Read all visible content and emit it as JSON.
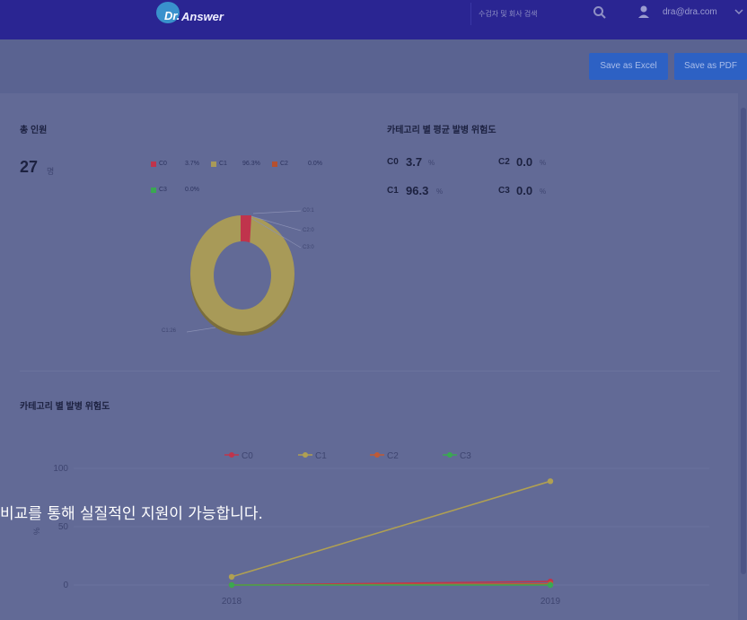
{
  "header": {
    "logo_mark": "Dr.",
    "logo_name": "Answer",
    "search_placeholder": "수검자 및 회사 검색",
    "user_email": "dra@dra.com"
  },
  "toolbar": {
    "save_excel": "Save as Excel",
    "save_pdf": "Save as PDF"
  },
  "summary": {
    "total_title": "총 인원",
    "total_value": "27",
    "total_unit": "명",
    "avg_title": "카테고리 별 평균 발병 위험도",
    "legend": [
      {
        "label": "C0",
        "pct": "3.7%",
        "color": "#c0344c"
      },
      {
        "label": "C1",
        "pct": "96.3%",
        "color": "#a89a58"
      },
      {
        "label": "C2",
        "pct": "0.0%",
        "color": "#b5502f"
      },
      {
        "label": "C3",
        "pct": "0.0%",
        "color": "#3aa852"
      }
    ],
    "donut_labels": [
      "C0:1",
      "C2:0",
      "C3:0",
      "C1:26"
    ],
    "stats": [
      {
        "label": "C0",
        "value": "3.7",
        "unit": "%"
      },
      {
        "label": "C2",
        "value": "0.0",
        "unit": "%"
      },
      {
        "label": "C1",
        "value": "96.3",
        "unit": "%"
      },
      {
        "label": "C3",
        "value": "0.0",
        "unit": "%"
      }
    ]
  },
  "line_section": {
    "title": "카테고리 별 발병 위험도",
    "y_axis_label": "%"
  },
  "chart_data": {
    "type": "line",
    "x": [
      "2018",
      "2019"
    ],
    "series": [
      {
        "name": "C0",
        "values": [
          0,
          3
        ],
        "color": "#c0344c"
      },
      {
        "name": "C1",
        "values": [
          7,
          89
        ],
        "color": "#b0a052"
      },
      {
        "name": "C2",
        "values": [
          0,
          1
        ],
        "color": "#c05a35"
      },
      {
        "name": "C3",
        "values": [
          0,
          0
        ],
        "color": "#3aa852"
      }
    ],
    "ylim": [
      0,
      100
    ],
    "yticks": [
      "100",
      "50",
      "0"
    ],
    "ylabel": "%",
    "legend_position": "top-center",
    "grid": true
  },
  "overlay": {
    "caption": "비교를 통해 실질적인 지원이 가능합니다."
  }
}
